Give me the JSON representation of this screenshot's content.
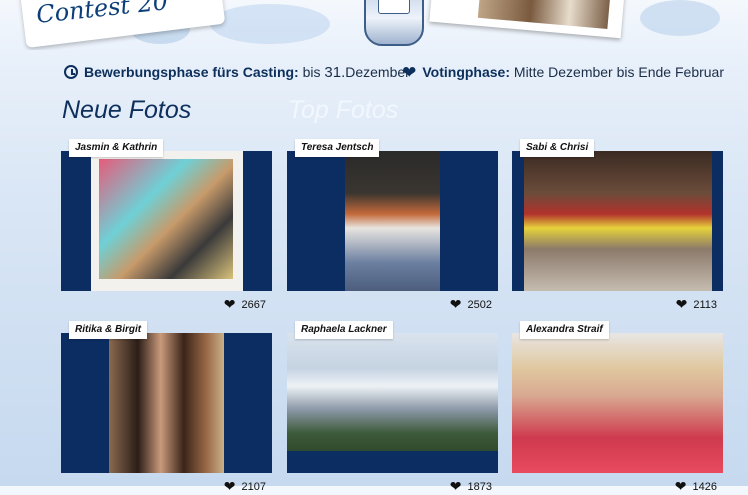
{
  "banner": {
    "contest_text": "Contest 20"
  },
  "info": {
    "casting_label": "Bewerbungsphase fürs Casting:",
    "casting_prefix": "bis",
    "casting_date": "31.",
    "casting_month": "Dezember",
    "voting_label": "Votingphase:",
    "voting_value": "Mitte Dezember bis Ende Februar"
  },
  "tabs": [
    {
      "label": "Neue Fotos",
      "active": true
    },
    {
      "label": "Top Fotos",
      "active": false
    }
  ],
  "photos": [
    {
      "name": "Jasmin & Kathrin",
      "votes": "2667"
    },
    {
      "name": "Teresa Jentsch",
      "votes": "2502"
    },
    {
      "name": "Sabi & Chrisi",
      "votes": "2113"
    },
    {
      "name": "Ritika & Birgit",
      "votes": "2107"
    },
    {
      "name": "Raphaela Lackner",
      "votes": "1873"
    },
    {
      "name": "Alexandra Straif",
      "votes": "1426"
    }
  ],
  "colors": {
    "frame": "#0b2d62",
    "heading": "#0c2f5c",
    "inactive_tab": "#f2f7fd"
  },
  "icons": {
    "casting": "clock-icon",
    "voting": "heart-icon",
    "votes": "heart-icon"
  }
}
